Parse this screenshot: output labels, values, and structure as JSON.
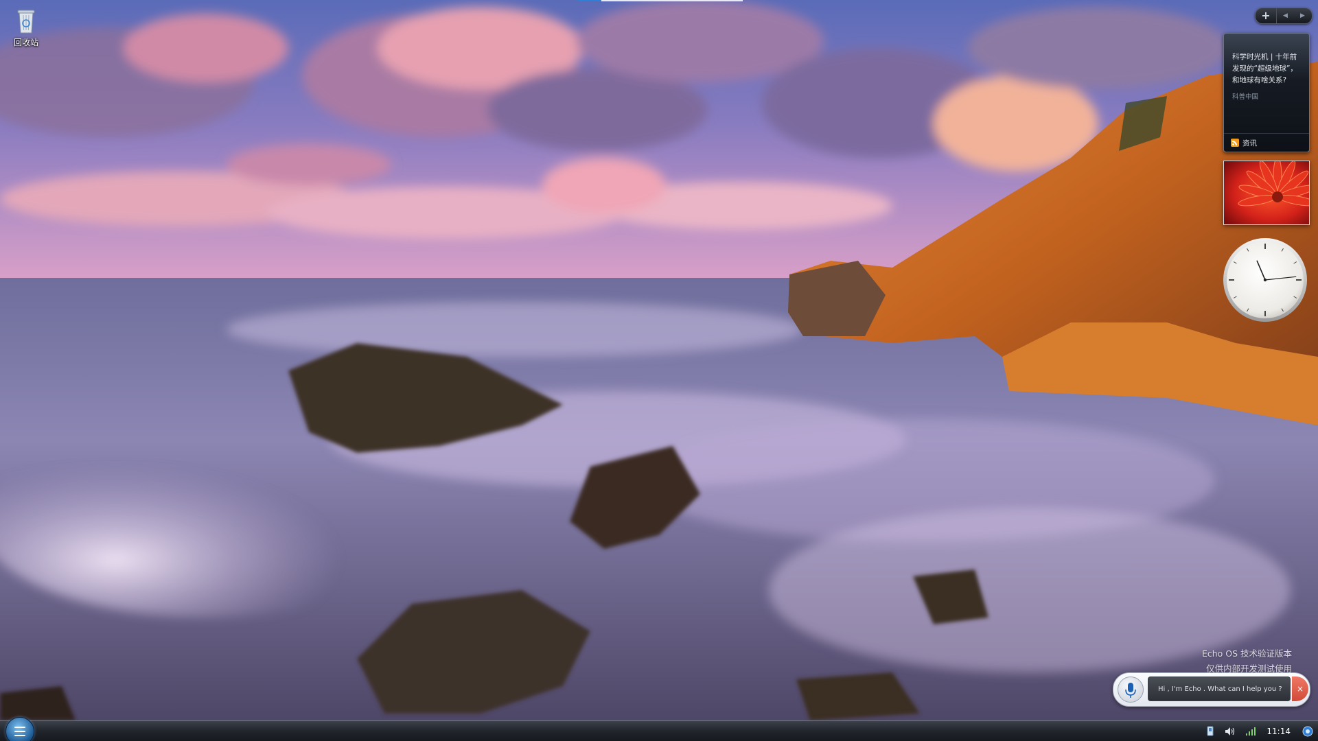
{
  "desktop": {
    "icons": [
      {
        "label": "回收站",
        "icon": "recycle-bin-icon"
      }
    ]
  },
  "top_strip": {
    "progress": 0.14
  },
  "gadget_bar": {
    "add_label": "+",
    "prev_label": "◀",
    "next_label": "▶"
  },
  "news_gadget": {
    "headline": "科学时光机 | 十年前发现的“超级地球”，和地球有啥关系?",
    "source": "科普中国",
    "footer_label": "资讯",
    "icon": "rss-icon"
  },
  "photo_gadget": {
    "subject": "red-flower-photo"
  },
  "clock_gadget": {
    "time": "11:14"
  },
  "watermark": {
    "line1": "Echo OS 技术验证版本",
    "line2": "仅供内部开发测试使用"
  },
  "echo": {
    "placeholder": "Hi , I'm Echo . What can I help you ?",
    "value": "",
    "close_label": "×",
    "mic_icon": "microphone-icon"
  },
  "taskbar": {
    "start_icon": "start-menu-icon",
    "tray": {
      "clock": "11:14",
      "icons": [
        "network-device-icon",
        "volume-icon",
        "signal-icon",
        "notification-icon"
      ]
    }
  },
  "colors": {
    "accent": "#2f7fd6",
    "taskbar": "#22262d",
    "echo_close": "#d04a37"
  }
}
